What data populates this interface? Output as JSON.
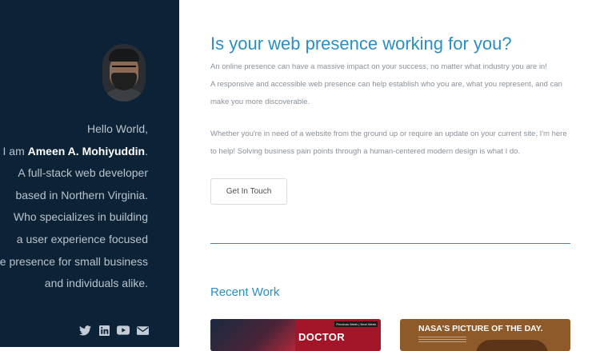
{
  "sidebar": {
    "intro": {
      "greeting": "Hello World,",
      "iam": "I am ",
      "name": "Ameen A. Mohiyuddin",
      "period": ".",
      "lines": [
        "A full-stack web developer",
        "based in Northern Virginia.",
        "Who specializes in building",
        "a user experience focused",
        "online presence for small business",
        "and individuals alike."
      ]
    },
    "socials": [
      "twitter-icon",
      "linkedin-icon",
      "youtube-icon",
      "mail-icon"
    ]
  },
  "main": {
    "heading": "Is your web presence working for you?",
    "para1_line1": "An online presence can have a massive impact on your success, no matter what industry you are in!",
    "para1_line2": "A responsive and accessible web presence can help establish who you are, what you represent, and can make you more discoverable.",
    "para2": "Whether you're in need of a website from the ground up or require an update on your current site, I'm here to help! Solving business pain points through a human-centered modern design is what I do.",
    "cta_label": "Get In Touch",
    "recent_title": "Recent Work",
    "cards": [
      {
        "title": "DOCTOR",
        "tabs": "Previous Week | Next Week"
      },
      {
        "title": "NASA'S PICTURE OF THE DAY."
      }
    ]
  },
  "colors": {
    "sidebar_bg": "#0c2236",
    "accent": "#2a8fc4",
    "body_text": "#8a9199"
  }
}
